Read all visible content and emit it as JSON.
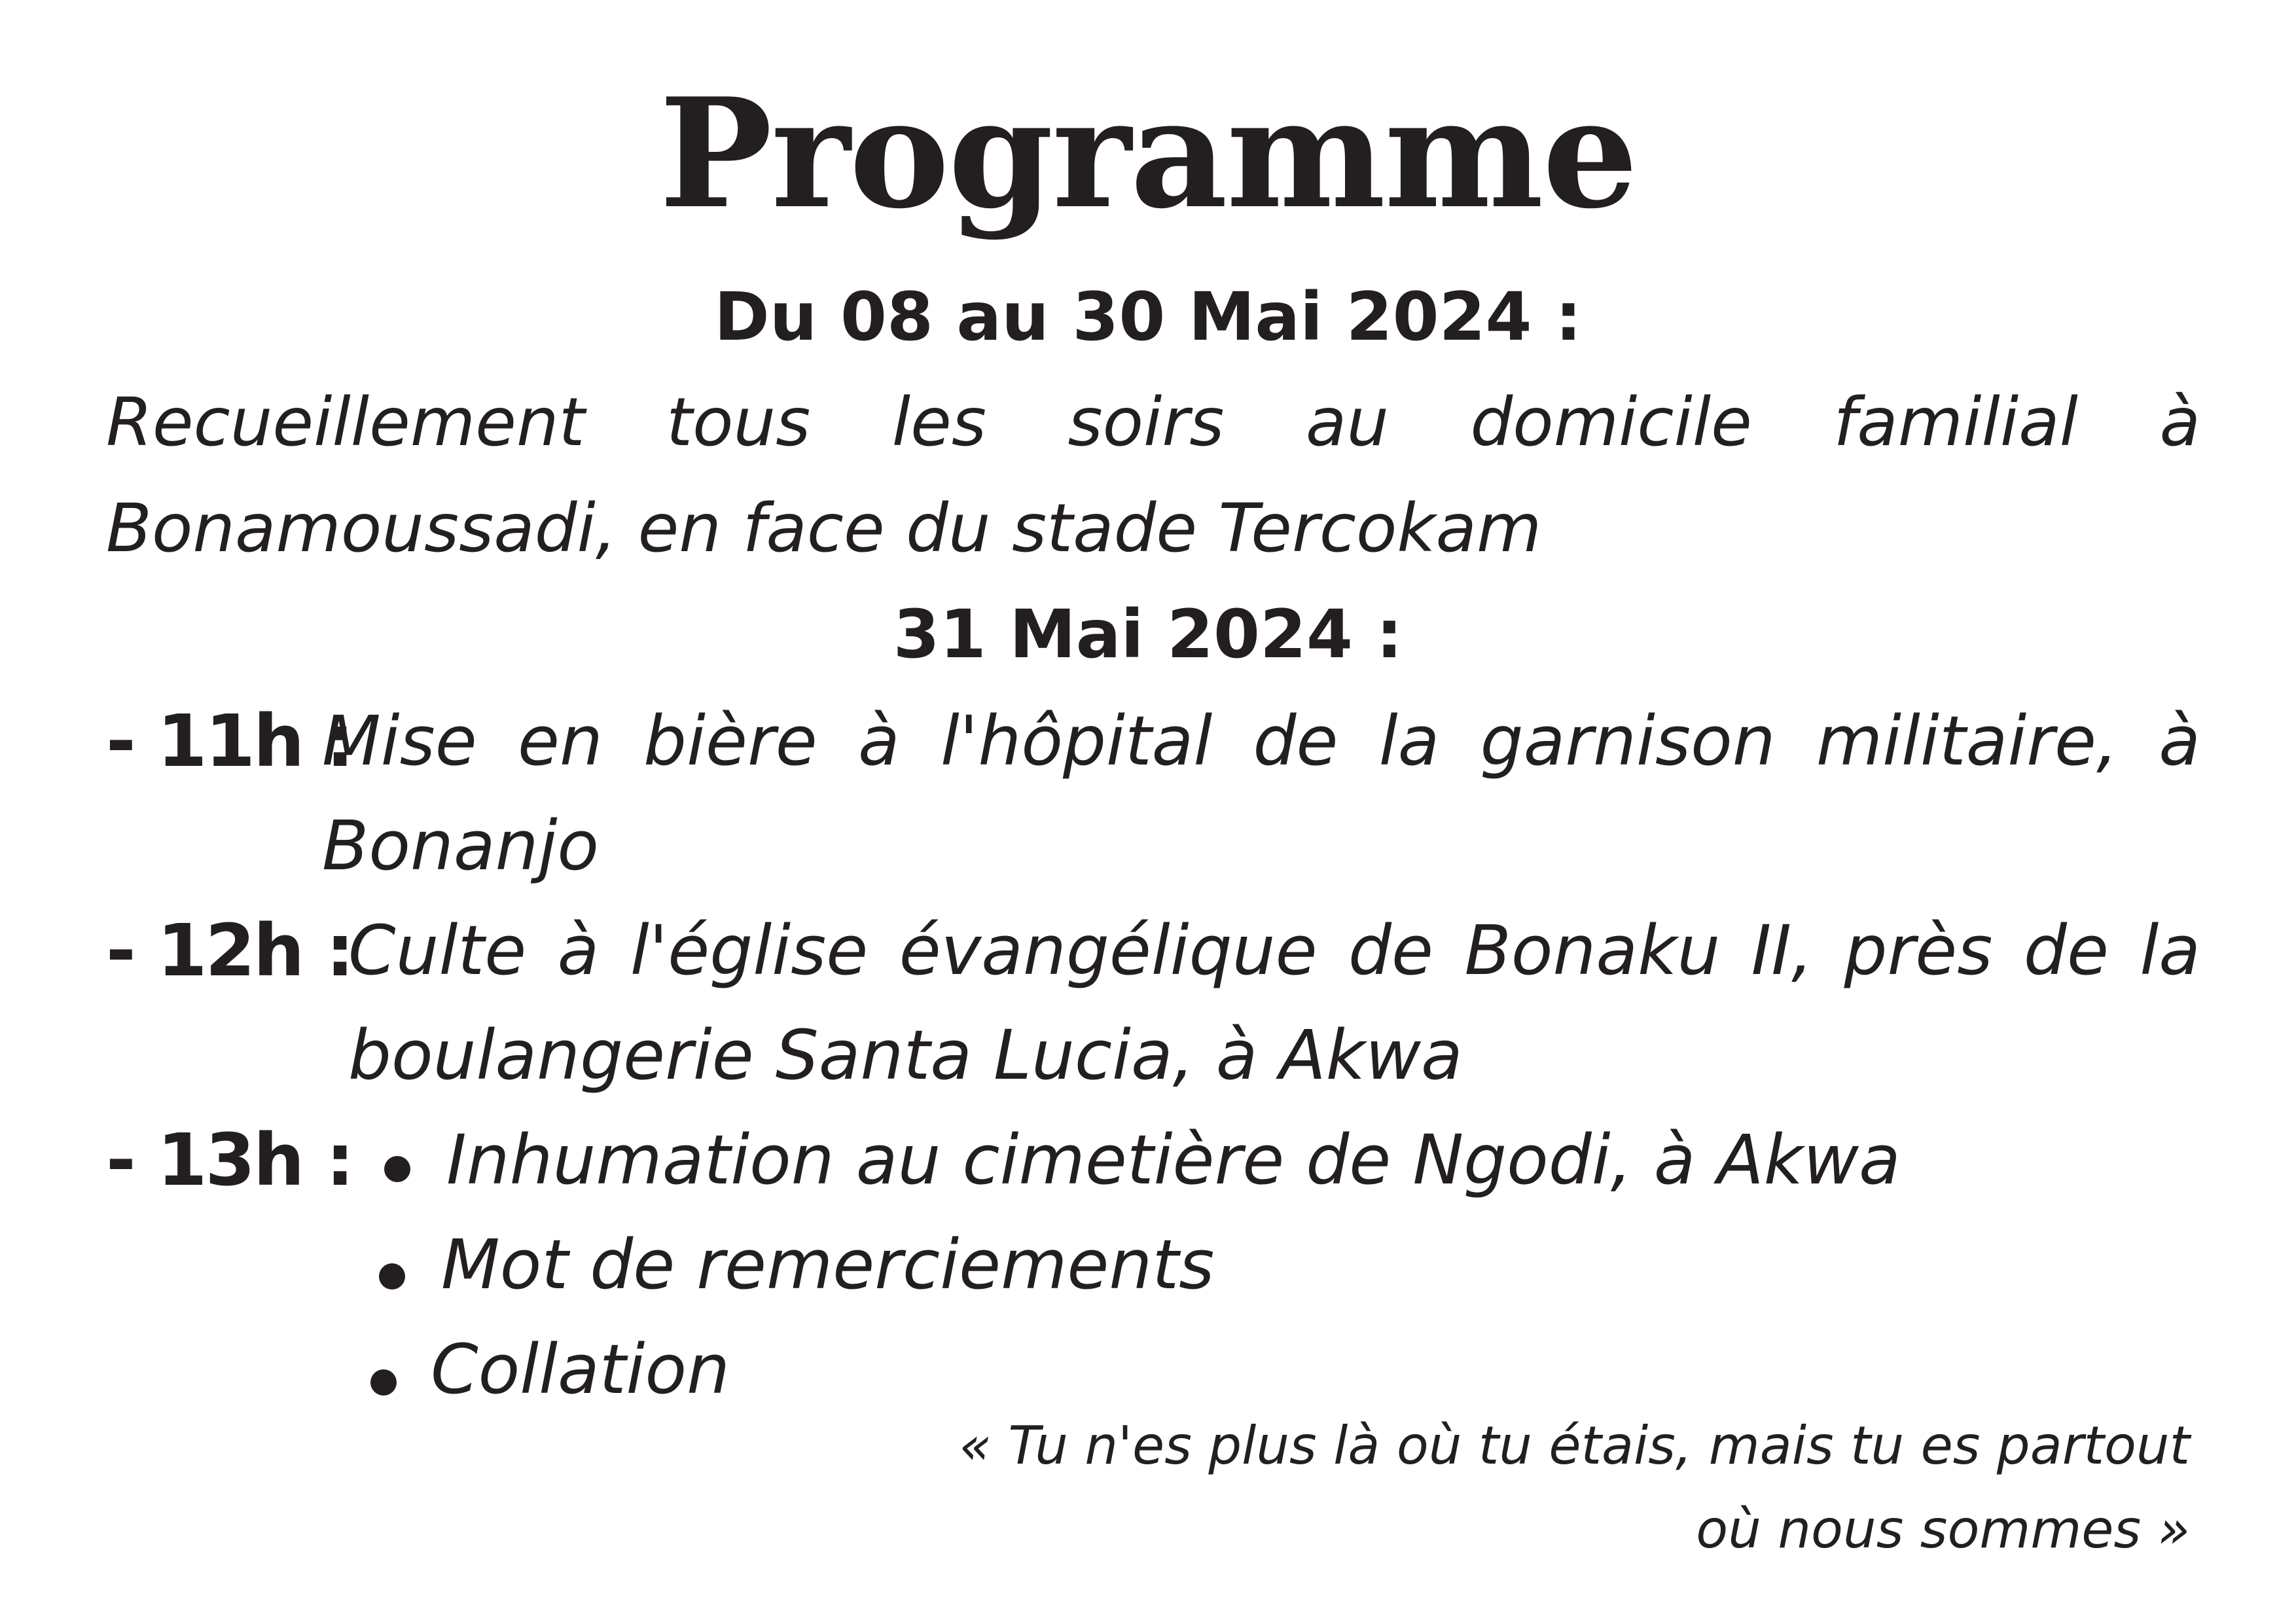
{
  "title": "Programme",
  "section1": {
    "heading": "Du 08 au 30 Mai 2024 :",
    "text": "Recueillement tous les soirs au domicile familial à Bonamoussadi, en face du stade Tercokam"
  },
  "section2": {
    "heading": "31 Mai 2024 :",
    "items": [
      {
        "time": "- 11h :",
        "text": "Mise en bière à l'hôpital de la garnison militaire, à Bonanjo"
      },
      {
        "time": "- 12h :",
        "text": "Culte à l'église évangélique de Bonaku II, près de la boulangerie Santa Lucia, à Akwa"
      },
      {
        "time": "- 13h :",
        "bullets": [
          "Inhumation au cimetière de Ngodi, à Akwa",
          "Mot de remerciements",
          "Collation"
        ]
      }
    ]
  },
  "quote": "« Tu n'es plus là où tu étais, mais tu es partout où nous sommes »"
}
